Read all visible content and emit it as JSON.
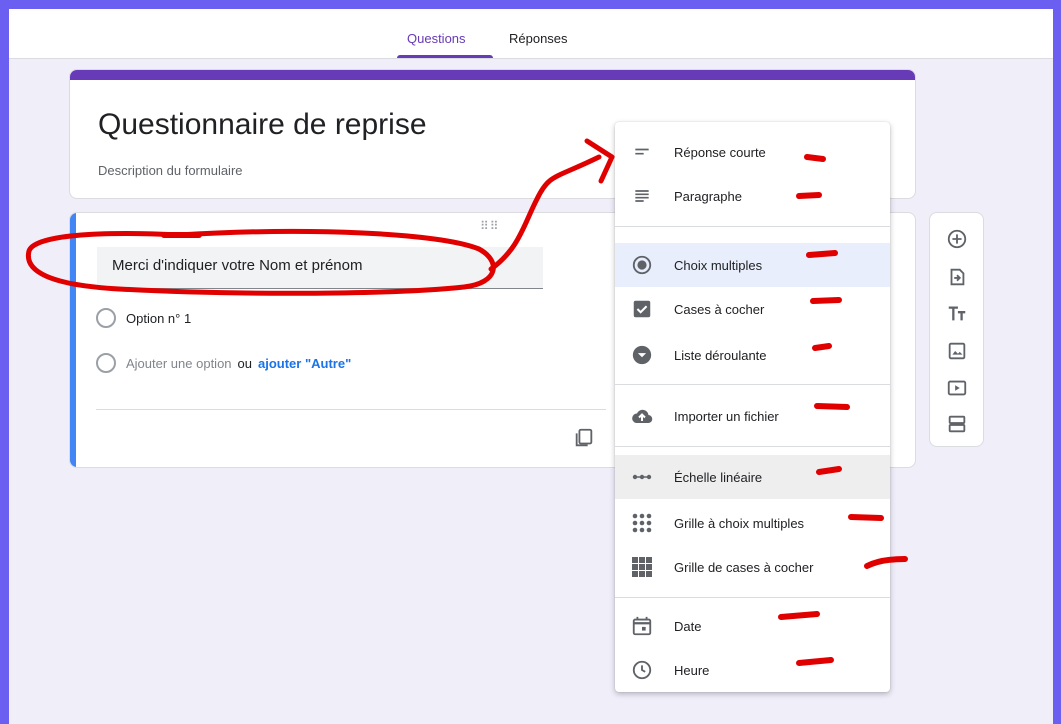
{
  "tabs": [
    {
      "label": "Questions",
      "active": true
    },
    {
      "label": "Réponses",
      "active": false
    }
  ],
  "form": {
    "title": "Questionnaire de reprise",
    "description": "Description du formulaire"
  },
  "question": {
    "text": "Merci d'indiquer votre Nom et prénom",
    "option1": "Option n° 1",
    "add_option": "Ajouter une option",
    "or": "ou",
    "add_other": "ajouter \"Autre\""
  },
  "menu": {
    "items": [
      {
        "label": "Réponse courte",
        "icon": "short-text-icon"
      },
      {
        "label": "Paragraphe",
        "icon": "paragraph-icon"
      },
      {
        "label": "Choix multiples",
        "icon": "radio-button-icon",
        "selected": true
      },
      {
        "label": "Cases à cocher",
        "icon": "checkbox-icon"
      },
      {
        "label": "Liste déroulante",
        "icon": "dropdown-icon"
      },
      {
        "label": "Importer un fichier",
        "icon": "cloud-upload-icon"
      },
      {
        "label": "Échelle linéaire",
        "icon": "linear-scale-icon"
      },
      {
        "label": "Grille à choix multiples",
        "icon": "grid-dots-icon"
      },
      {
        "label": "Grille de cases à cocher",
        "icon": "grid-squares-icon"
      },
      {
        "label": "Date",
        "icon": "calendar-icon"
      },
      {
        "label": "Heure",
        "icon": "clock-icon"
      }
    ]
  },
  "toolbar": {
    "icons": [
      "add-circle-icon",
      "import-question-icon",
      "title-text-icon",
      "image-icon",
      "video-icon",
      "section-icon"
    ]
  },
  "colors": {
    "accent": "#673ab7",
    "question_bar": "#4285f4",
    "annotation": "#e00000",
    "border": "#6b5ff2"
  }
}
